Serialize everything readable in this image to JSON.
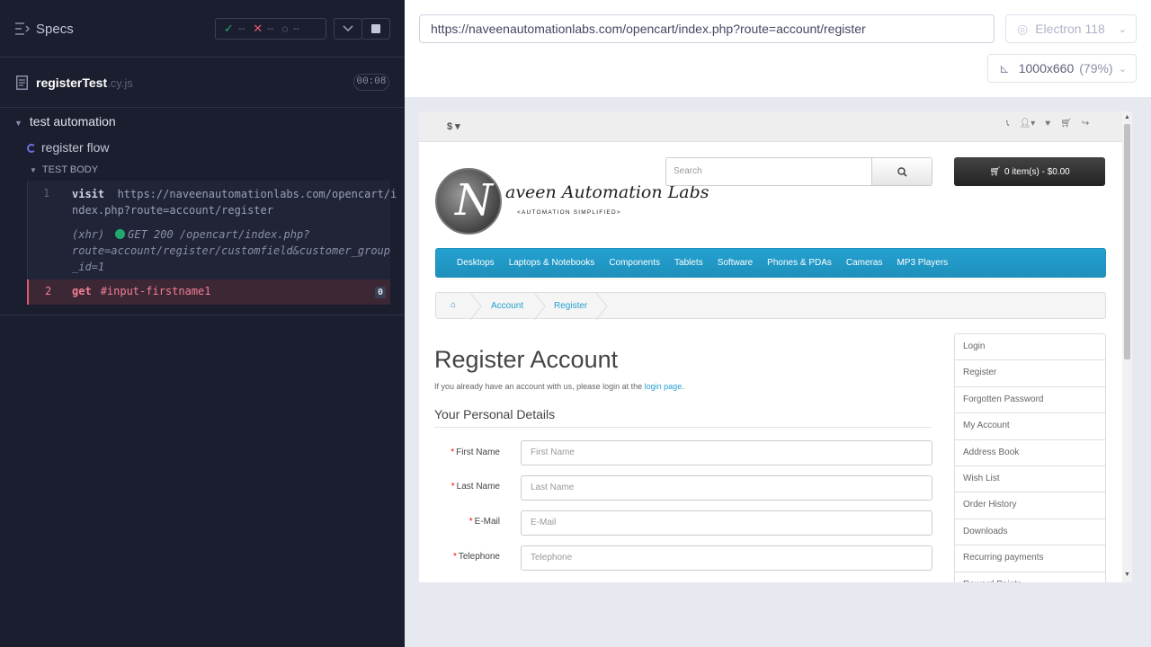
{
  "runner": {
    "specs_label": "Specs",
    "stats": {
      "passed": "--",
      "failed": "--",
      "pending": "--"
    },
    "file": {
      "name": "registerTest",
      "ext": ".cy.js",
      "duration": "00:08"
    },
    "suite": "test automation",
    "test": "register flow",
    "section": "TEST BODY",
    "commands": [
      {
        "num": "1",
        "name": "visit",
        "message": "https://naveenautomationlabs.com/opencart/index.php?route=account/register"
      },
      {
        "num": "",
        "name": "(xhr)",
        "message": "GET 200 /opencart/index.php?route=account/register/customfield&customer_group_id=1"
      },
      {
        "num": "2",
        "name": "get",
        "message": "#input-firstname1",
        "badge": "0"
      }
    ],
    "cmd1_line1": "https://naveenautomationlabs.com/opencart/i",
    "cmd1_line2": "ndex.php?route=account/register",
    "xhr_line1": "GET 200 /opencart/index.php?",
    "xhr_line2": "route=account/register/customfield&customer_group",
    "xhr_line3": "_id=1"
  },
  "browser_bar": {
    "url": "https://naveenautomationlabs.com/opencart/index.php?route=account/register",
    "browser": "Electron 118",
    "viewport": "1000x660",
    "scale": "(79%)"
  },
  "site": {
    "currency": "$",
    "logo_text": "aveen Automation Labs",
    "logo_sub": "<AUTOMATION SIMPLIFIED>",
    "search_placeholder": "Search",
    "cart": "0 item(s) - $0.00",
    "menu": [
      "Desktops",
      "Laptops & Notebooks",
      "Components",
      "Tablets",
      "Software",
      "Phones & PDAs",
      "Cameras",
      "MP3 Players"
    ],
    "breadcrumb": [
      "Account",
      "Register"
    ],
    "heading": "Register Account",
    "intro_text": "If you already have an account with us, please login at the ",
    "intro_link": "login page",
    "intro_end": ".",
    "legend": "Your Personal Details",
    "fields": [
      {
        "label": "First Name",
        "placeholder": "First Name"
      },
      {
        "label": "Last Name",
        "placeholder": "Last Name"
      },
      {
        "label": "E-Mail",
        "placeholder": "E-Mail"
      },
      {
        "label": "Telephone",
        "placeholder": "Telephone"
      }
    ],
    "sidebar": [
      "Login",
      "Register",
      "Forgotten Password",
      "My Account",
      "Address Book",
      "Wish List",
      "Order History",
      "Downloads",
      "Recurring payments",
      "Reward Points"
    ]
  },
  "colors": {
    "accent": "#23a1d1",
    "pass": "#1fa971",
    "fail": "#e45770"
  }
}
